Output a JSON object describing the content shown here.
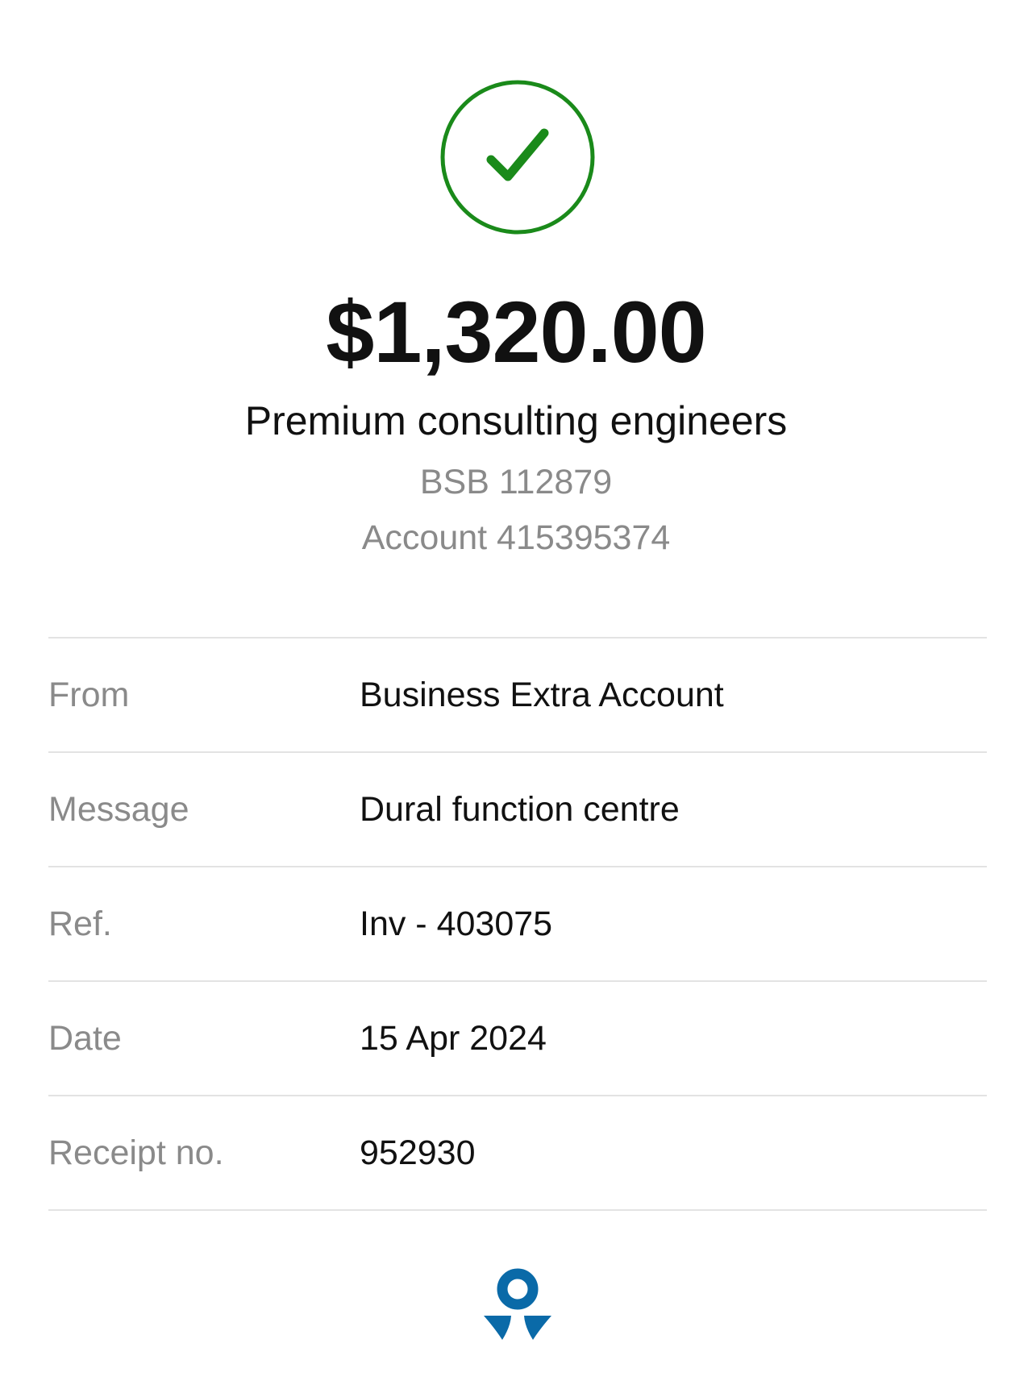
{
  "status": {
    "icon": "check-circle-icon",
    "color": "#1a8a1a"
  },
  "payment": {
    "amount": "$1,320.00",
    "payee_name": "Premium consulting engineers",
    "bsb": "BSB 112879",
    "account": "Account 415395374"
  },
  "details": [
    {
      "label": "From",
      "value": "Business Extra Account"
    },
    {
      "label": "Message",
      "value": "Dural function centre"
    },
    {
      "label": "Ref.",
      "value": "Inv - 403075"
    },
    {
      "label": "Date",
      "value": "15 Apr 2024"
    },
    {
      "label": "Receipt no.",
      "value": "952930"
    }
  ],
  "footer": {
    "logo_icon": "bank-logo-icon",
    "brand_color": "#0a6aa8"
  }
}
